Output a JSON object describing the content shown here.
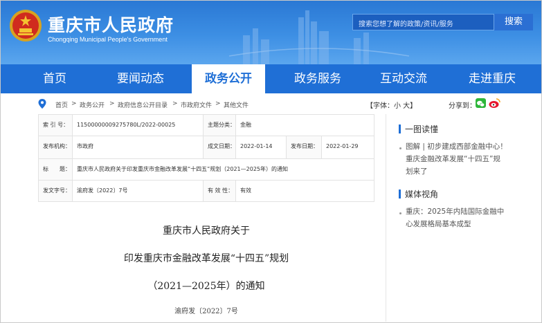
{
  "header": {
    "site_title": "重庆市人民政府",
    "site_subtitle": "Chongqing Municipal People's Government",
    "search_placeholder": "搜索您想了解的政策/资讯/服务",
    "search_button": "搜索",
    "colors": {
      "header_blue": "#2a78d4",
      "nav_blue": "#1f6fd6"
    }
  },
  "nav": {
    "items": [
      "首页",
      "要闻动态",
      "政务公开",
      "政务服务",
      "互动交流",
      "走进重庆"
    ],
    "active": "政务公开"
  },
  "breadcrumb": {
    "items": [
      "首页",
      ">",
      "政务公开",
      ">",
      "政府信息公开目录",
      ">",
      "市政府文件",
      ">",
      "其他文件"
    ],
    "font_size_label": "【字体：小 大】",
    "share_label": "分享到："
  },
  "info": {
    "index_label": "索 引 号：",
    "index_value": "11500000009275780L/2022-00025",
    "topic_label": "主题分类：",
    "topic_value": "金融",
    "publisher_label": "发布机构：",
    "publisher_value": "市政府",
    "created_label": "成文日期：",
    "created_value": "2022-01-14",
    "published_label": "发布日期：",
    "published_value": "2022-01-29",
    "title_label": "标　　题：",
    "title_value": "重庆市人民政府关于印发重庆市金融改革发展“十四五”规划（2021—2025年）的通知",
    "docno_label": "发文字号：",
    "docno_value": "渝府发〔2022〕7号",
    "valid_label": "有 效 性：",
    "valid_value": "有效"
  },
  "sidebar": {
    "section1_title": "一图读懂",
    "section1_item_lines": [
      "图解 | 初步建成西部金融中心！",
      "重庆金融改革发展“十四五”规",
      "划来了"
    ],
    "section2_title": "媒体视角",
    "section2_item_lines": [
      "重庆：2025年内陆国际金融中",
      "心发展格局基本成型"
    ]
  },
  "document": {
    "title_line1": "重庆市人民政府关于",
    "title_line2": "印发重庆市金融改革发展“十四五”规划",
    "title_line3": "（2021—2025年）的通知",
    "doc_number": "渝府发〔2022〕7号"
  }
}
